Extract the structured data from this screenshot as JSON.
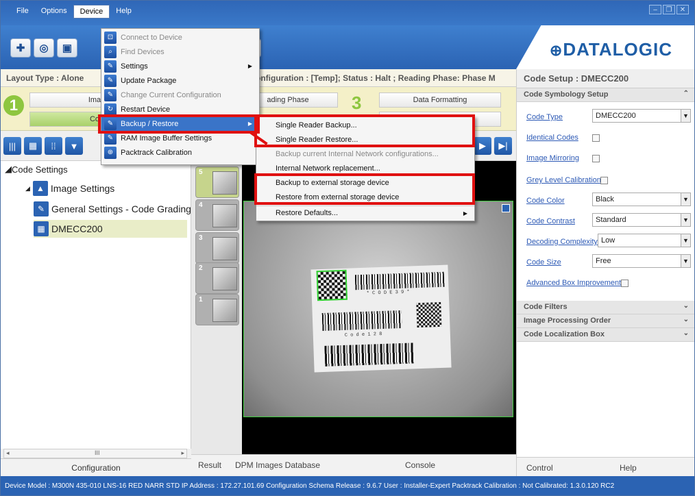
{
  "menubar": {
    "file": "File",
    "options": "Options",
    "device": "Device",
    "help": "Help"
  },
  "logo": "DATALOGIC",
  "infobar": {
    "left": "Layout Type : Alone",
    "right": "onfiguration : [Temp]; Status : Halt ; Reading Phase: Phase M"
  },
  "steps": {
    "btn1": "Ima",
    "btn1b": "Co",
    "btn2": "ading Phase",
    "num3": "3",
    "btn3": "Data Formatting"
  },
  "tree": {
    "root": "Code Settings",
    "image": "Image Settings",
    "general": "General Settings - Code Grading",
    "dmecc": "DMECC200"
  },
  "thumbs": [
    "5",
    "4",
    "3",
    "2",
    "1"
  ],
  "image_text": {
    "code39": "* C O D E   3 9 *",
    "code128": "C o d e   1 2 8"
  },
  "scroll_mark": "III",
  "left_tab": "Configuration",
  "bottom_tabs": {
    "result": "Result",
    "dpm": "DPM Images Database",
    "console": "Console"
  },
  "right_panel": {
    "title": "Code Setup : DMECC200",
    "section_symbology": "Code Symbology Setup",
    "code_type_label": "Code Type",
    "code_type_value": "DMECC200",
    "identical_codes": "Identical Codes",
    "image_mirroring": "Image Mirroring",
    "grey_level": "Grey Level Calibration",
    "code_color_label": "Code Color",
    "code_color_value": "Black",
    "code_contrast_label": "Code Contrast",
    "code_contrast_value": "Standard",
    "decoding_label": "Decoding Complexity",
    "decoding_value": "Low",
    "code_size_label": "Code Size",
    "code_size_value": "Free",
    "advanced_box": "Advanced Box Improvement",
    "code_filters": "Code Filters",
    "image_processing": "Image Processing Order",
    "code_localization": "Code Localization Box",
    "tab_control": "Control",
    "tab_help": "Help"
  },
  "device_menu": [
    {
      "label": "Connect to Device",
      "disabled": true
    },
    {
      "label": "Find Devices",
      "disabled": true
    },
    {
      "label": "Settings"
    },
    {
      "label": "Update Package"
    },
    {
      "label": "Change Current Configuration",
      "disabled": true
    },
    {
      "label": "Restart Device"
    },
    {
      "label": "Backup / Restore"
    },
    {
      "label": "RAM Image Buffer Settings"
    },
    {
      "label": "Packtrack Calibration"
    }
  ],
  "backup_menu": [
    {
      "label": "Single Reader Backup..."
    },
    {
      "label": "Single Reader Restore..."
    },
    {
      "label": "Backup current Internal Network configurations...",
      "disabled": true
    },
    {
      "label": "Internal Network replacement..."
    },
    {
      "label": "Backup to external storage device"
    },
    {
      "label": "Restore from external storage device"
    },
    {
      "label": "Restore Defaults..."
    }
  ],
  "status_bar": "Device Model : M300N 435-010 LNS-16 RED NARR STD   IP Address :  172.27.101.69   Configuration Schema Release :  9.6.7   User : Installer-Expert   Packtrack Calibration : Not Calibrated: 1.3.0.120 RC2",
  "colors": {
    "accent": "#2b63b3",
    "green": "#8ec63f",
    "highlight_red": "#e01010"
  }
}
